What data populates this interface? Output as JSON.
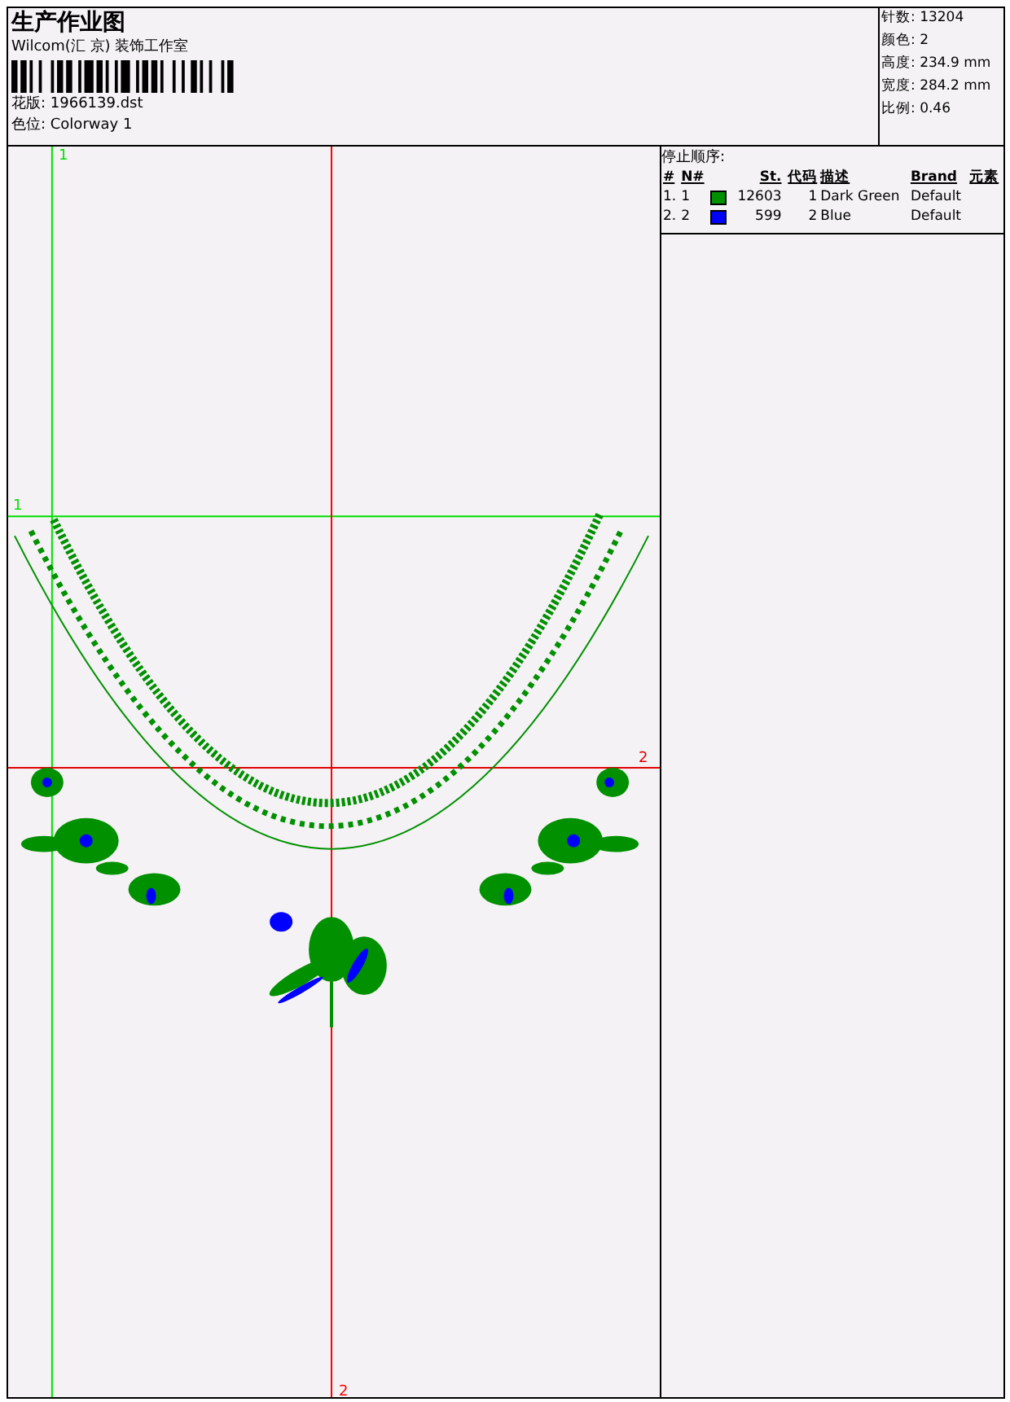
{
  "header": {
    "title": "生产作业图",
    "company": "Wilcom(汇 京) 装饰工作室",
    "fields": [
      {
        "label": "花版:",
        "value": "1966139.dst"
      },
      {
        "label": "色位:",
        "value": "Colorway 1"
      }
    ]
  },
  "stats": [
    {
      "label": "针数:",
      "value": "13204"
    },
    {
      "label": "颜色:",
      "value": "2"
    },
    {
      "label": "高度:",
      "value": "234.9 mm"
    },
    {
      "label": "宽度:",
      "value": "284.2 mm"
    },
    {
      "label": "比例:",
      "value": "0.46"
    }
  ],
  "stop_sequence": {
    "title": "停止顺序:",
    "columns": [
      "#",
      "N#",
      "St.",
      "代码",
      "描述",
      "Brand",
      "元素"
    ],
    "rows": [
      {
        "index": "1.",
        "number": "1",
        "color": "#009000",
        "stitches": "12603",
        "code": "1",
        "description": "Dark Green",
        "brand": "Default"
      },
      {
        "index": "2.",
        "number": "2",
        "color": "#0000ff",
        "stitches": "599",
        "code": "2",
        "description": "Blue",
        "brand": "Default"
      }
    ]
  },
  "guides": [
    {
      "kind": "vertical",
      "color": "#00e000",
      "label": "1"
    },
    {
      "kind": "horizontal",
      "color": "#00e000",
      "label": "1"
    },
    {
      "kind": "vertical",
      "color": "#ff0000",
      "label": "2"
    },
    {
      "kind": "horizontal",
      "color": "#e00000",
      "label": "2"
    }
  ]
}
